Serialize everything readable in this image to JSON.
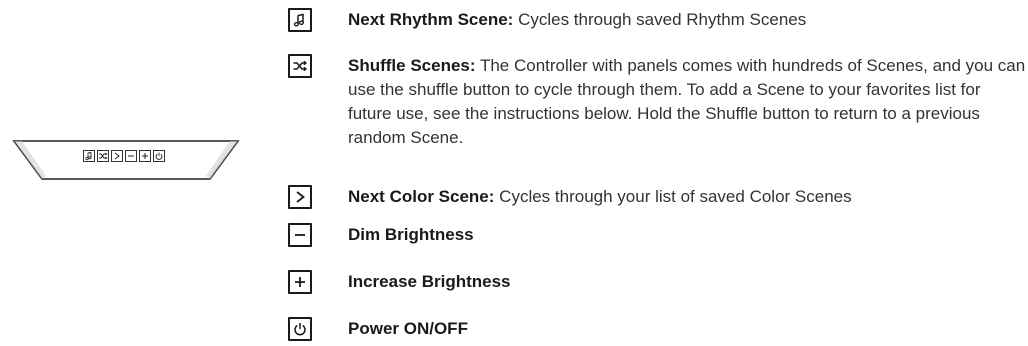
{
  "items": [
    {
      "icon": "music-note-icon",
      "title": "Next Rhythm Scene:",
      "description": "Cycles through saved Rhythm Scenes"
    },
    {
      "icon": "shuffle-icon",
      "title": "Shuffle Scenes:",
      "description": "The Controller with panels comes with hundreds of Scenes, and you can use the shuffle button to cycle through them. To add a Scene to your favorites list for future use, see the instructions below. Hold the Shuffle button to return to a previous random Scene."
    },
    {
      "icon": "chevron-right-icon",
      "title": "Next Color Scene:",
      "description": "Cycles through your list of saved Color Scenes"
    },
    {
      "icon": "minus-icon",
      "title": "Dim Brightness",
      "description": ""
    },
    {
      "icon": "plus-icon",
      "title": "Increase Brightness",
      "description": ""
    },
    {
      "icon": "power-icon",
      "title": "Power ON/OFF",
      "description": ""
    }
  ],
  "colors": {
    "text": "#333333",
    "title": "#1a1a1a",
    "border": "#1a1a1a"
  }
}
